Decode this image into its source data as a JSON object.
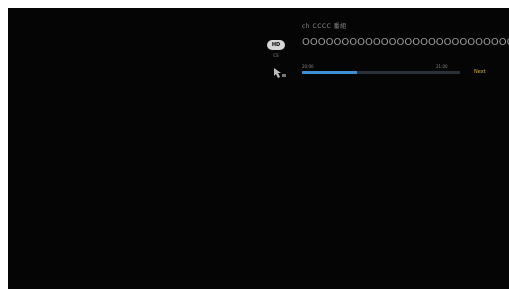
{
  "overlay": {
    "channel_line": "ch CCCC 番組",
    "program_title": "OOOOOOOOOOOOOOOOOOOOOOOOOOOOOOOOOOOOOOOOOOOOOO",
    "badge_text": "HD",
    "badge_caption": "CS",
    "genre_icon": "cursor-icon",
    "start_time": "20:00",
    "end_time": "21:00",
    "progress_percent": 35,
    "status_label": "Next"
  }
}
